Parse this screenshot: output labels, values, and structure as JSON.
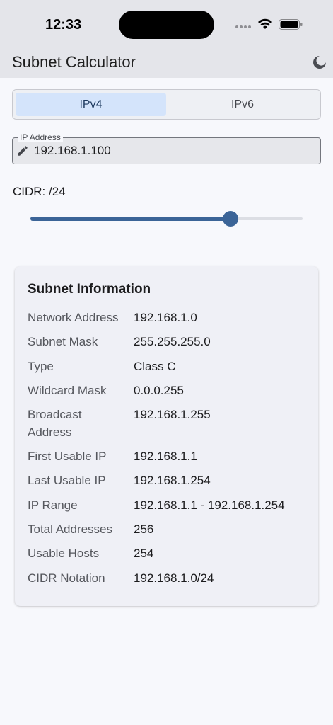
{
  "status_bar": {
    "time": "12:33",
    "icons": [
      "signal-dots-icon",
      "wifi-icon",
      "battery-icon"
    ]
  },
  "app_bar": {
    "title": "Subnet Calculator",
    "theme_icon": "moon-icon"
  },
  "ip_version": {
    "options": [
      "IPv4",
      "IPv6"
    ],
    "selected": "IPv4"
  },
  "ip_input": {
    "label": "IP Address",
    "value": "192.168.1.100",
    "icon": "pencil-icon"
  },
  "cidr": {
    "label": "CIDR: /24",
    "value": 24,
    "min": 0,
    "max": 32
  },
  "subnet_info": {
    "title": "Subnet Information",
    "rows": [
      {
        "label": "Network Address",
        "value": "192.168.1.0"
      },
      {
        "label": "Subnet Mask",
        "value": "255.255.255.0"
      },
      {
        "label": "Type",
        "value": "Class C"
      },
      {
        "label": "Wildcard Mask",
        "value": "0.0.0.255"
      },
      {
        "label": "Broadcast Address",
        "value": "192.168.1.255"
      },
      {
        "label": "First Usable IP",
        "value": "192.168.1.1"
      },
      {
        "label": "Last Usable IP",
        "value": "192.168.1.254"
      },
      {
        "label": "IP Range",
        "value": "192.168.1.1 - 192.168.1.254"
      },
      {
        "label": "Total Addresses",
        "value": "256"
      },
      {
        "label": "Usable Hosts",
        "value": "254"
      },
      {
        "label": "CIDR Notation",
        "value": "192.168.1.0/24"
      }
    ]
  },
  "colors": {
    "accent": "#3b6497",
    "selected_segment": "#d4e4fb",
    "app_bar": "#e4e5ea",
    "card": "#eff0f6"
  }
}
